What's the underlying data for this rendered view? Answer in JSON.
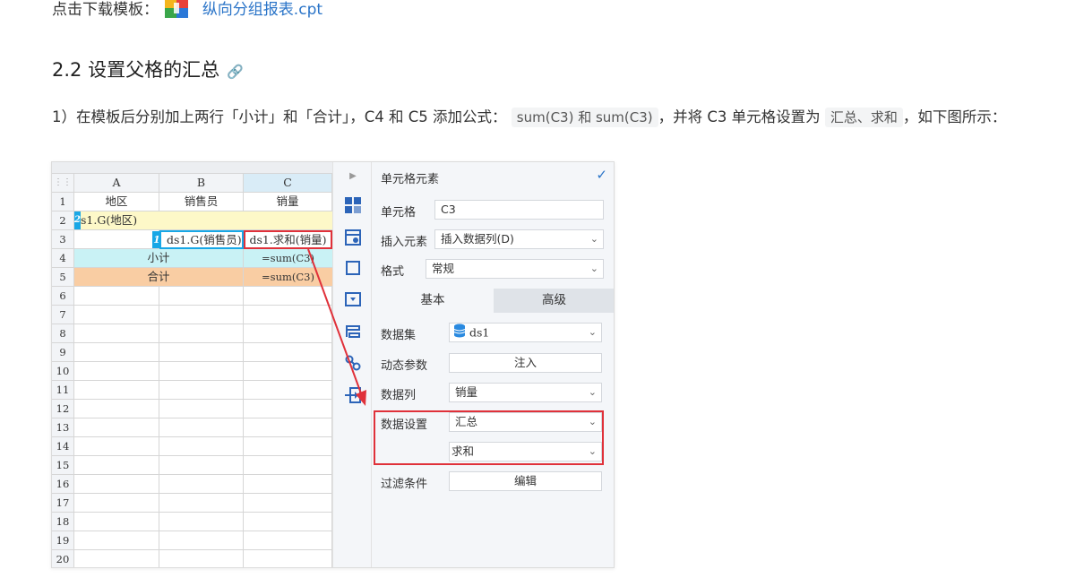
{
  "doc": {
    "download_prefix": "点击下载模板：",
    "download_file": "纵向分组报表.cpt",
    "heading": "2.2 设置父格的汇总",
    "para_1": "1）在模板后分别加上两行「小计」和「合计」，C4 和 C5 添加公式：",
    "code_1": "sum(C3) 和 sum(C3)",
    "para_2": "，并将 C3 单元格设置为",
    "code_2": "汇总、求和",
    "para_3": "，如下图所示："
  },
  "grid": {
    "cols": [
      "A",
      "B",
      "C"
    ],
    "row_numbers": [
      "1",
      "2",
      "3",
      "4",
      "5",
      "6",
      "7",
      "8",
      "9",
      "10",
      "11",
      "12",
      "13",
      "14",
      "15",
      "16",
      "17",
      "18",
      "19",
      "20"
    ],
    "r1": [
      "地区",
      "销售员",
      "销量"
    ],
    "r2_a": "s1.G(地区)",
    "r2_marker": "2",
    "r3_b": "ds1.G(销售员)",
    "r3_marker": "1",
    "r3_c": "ds1.求和(销量)",
    "r4_ab": "小计",
    "r4_c": "=sum(C3)",
    "r5_ab": "合计",
    "r5_c": "=sum(C3)",
    "colors": {
      "header_sel": "#d9ecf7",
      "row2": "#fdf8c8",
      "row4": "#c9f2f5",
      "row5": "#f9cda3",
      "marker": "#18a7e6",
      "highlight": "#e0313a"
    }
  },
  "panel": {
    "title": "单元格元素",
    "cell_label": "单元格",
    "cell_value": "C3",
    "insert_label": "插入元素",
    "insert_value": "插入数据列(D)",
    "format_label": "格式",
    "format_value": "常规",
    "tab_basic": "基本",
    "tab_advanced": "高级",
    "dataset_label": "数据集",
    "dataset_value": "ds1",
    "param_label": "动态参数",
    "param_button": "注入",
    "column_label": "数据列",
    "column_value": "销量",
    "setting_label": "数据设置",
    "setting_value": "汇总",
    "agg_value": "求和",
    "filter_label": "过滤条件",
    "filter_button": "编辑"
  }
}
